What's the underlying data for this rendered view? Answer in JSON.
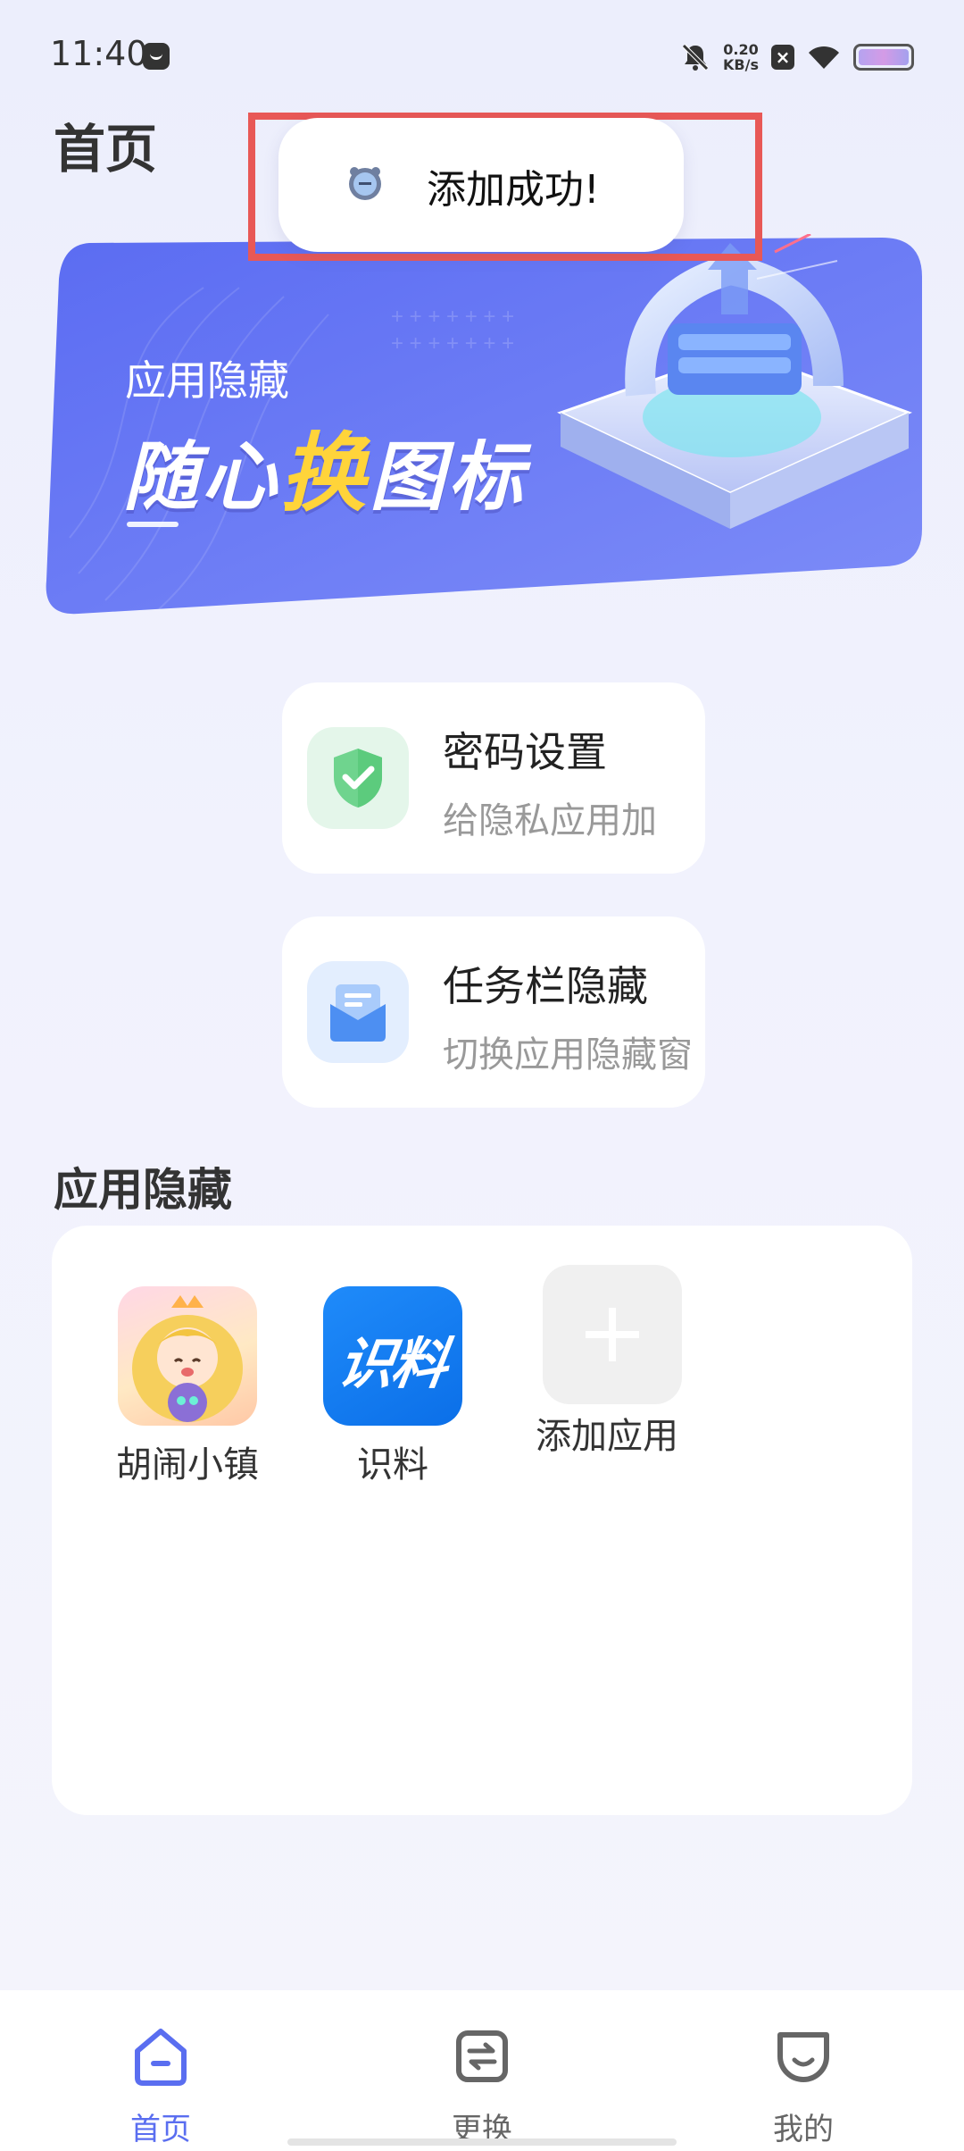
{
  "status_bar": {
    "time": "11:40",
    "net_speed_value": "0.20",
    "net_speed_unit": "KB/s",
    "icons": [
      "notification-app-icon",
      "bell-mute-icon",
      "close-box-icon",
      "wifi-icon",
      "battery-icon"
    ]
  },
  "header": {
    "title": "首页"
  },
  "toast": {
    "text": "添加成功!"
  },
  "banner": {
    "subtitle": "应用隐藏",
    "title_part1": "随心",
    "title_highlight": "换",
    "title_part2": "图标",
    "colors": {
      "start": "#5b6cf2",
      "end": "#7d8cf8",
      "highlight": "#ffd43a"
    }
  },
  "cards": [
    {
      "title": "密码设置",
      "subtitle": "给隐私应用加",
      "icon": "shield-check-icon",
      "accent": "#5ccb7d"
    },
    {
      "title": "任务栏隐藏",
      "subtitle": "切换应用隐藏窗",
      "icon": "envelope-icon",
      "accent": "#4d8ff2"
    }
  ],
  "apps_section": {
    "title": "应用隐藏",
    "apps": [
      {
        "label": "胡闹小镇",
        "icon": "game-character-icon"
      },
      {
        "label": "识料",
        "icon_text": "识料"
      }
    ],
    "add_label": "添加应用"
  },
  "bottom_nav": {
    "items": [
      {
        "label": "首页",
        "icon": "home-icon",
        "active": true
      },
      {
        "label": "更换",
        "icon": "swap-icon",
        "active": false
      },
      {
        "label": "我的",
        "icon": "profile-icon",
        "active": false
      }
    ],
    "active_color": "#5a6ef0"
  }
}
